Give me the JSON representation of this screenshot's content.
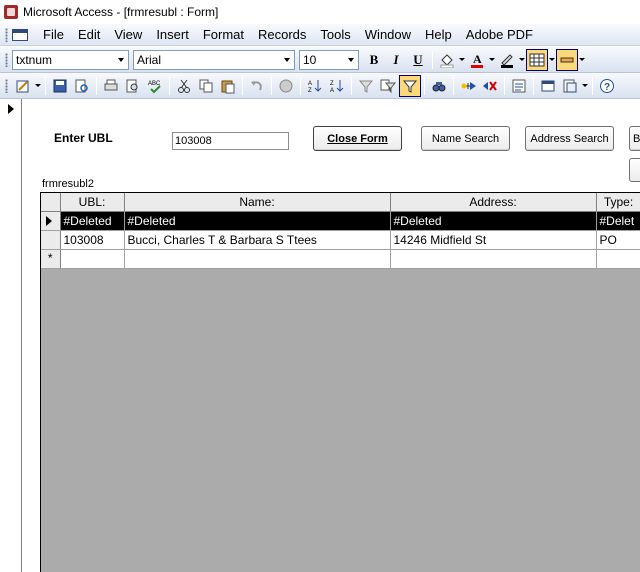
{
  "window": {
    "title": "Microsoft Access - [frmresubl : Form]"
  },
  "menu": {
    "items": [
      {
        "id": "file",
        "label": "File"
      },
      {
        "id": "edit",
        "label": "Edit"
      },
      {
        "id": "view",
        "label": "View"
      },
      {
        "id": "insert",
        "label": "Insert"
      },
      {
        "id": "format",
        "label": "Format"
      },
      {
        "id": "records",
        "label": "Records"
      },
      {
        "id": "tools",
        "label": "Tools"
      },
      {
        "id": "window",
        "label": "Window"
      },
      {
        "id": "help",
        "label": "Help"
      },
      {
        "id": "adobe",
        "label": "Adobe PDF"
      }
    ]
  },
  "formatting": {
    "object": "txtnum",
    "font": "Arial",
    "size": "10",
    "bold": "B",
    "italic": "I",
    "underline": "U"
  },
  "form": {
    "enter_label": "Enter UBL",
    "ubl_value": "103008",
    "close_label": "Close Form",
    "name_search_label": "Name Search",
    "address_search_label": "Address Search",
    "b_label": "B",
    "subform_label": "frmresubl2"
  },
  "grid": {
    "columns": [
      "UBL:",
      "Name:",
      "Address:",
      "Type:"
    ],
    "rows": [
      {
        "ubl": "#Deleted",
        "name": "#Deleted",
        "address": "#Deleted",
        "type": "#Delet"
      },
      {
        "ubl": "103008",
        "name": "Bucci, Charles T & Barbara S Ttees",
        "address": "14246 Midfield St",
        "type": "PO"
      }
    ],
    "new_row_marker": "*"
  },
  "colors": {
    "selected_row": "#000000",
    "empty_area": "#ababab",
    "toolbar_top": "#f7f9fc",
    "toolbar_bottom": "#d9e2f0"
  }
}
